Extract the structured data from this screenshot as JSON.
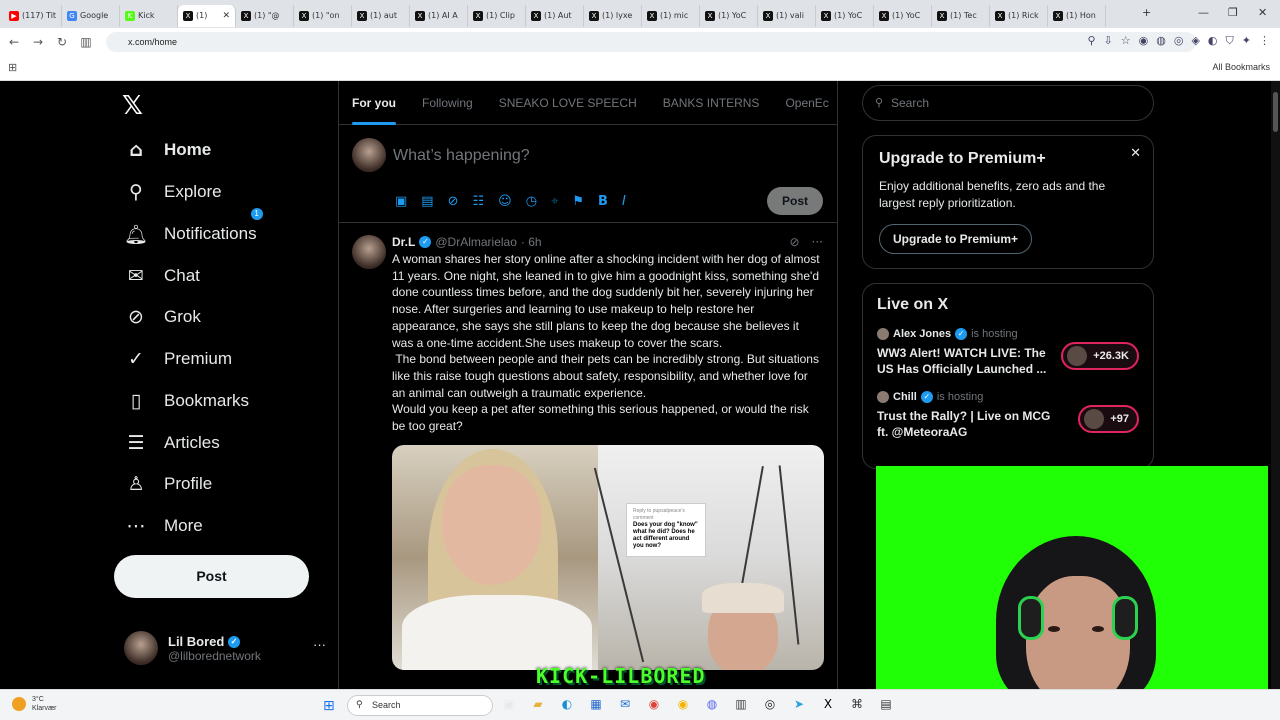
{
  "browser": {
    "tabs": [
      {
        "label": "(117) Tit",
        "fav": "▶",
        "fav_color": "#ff0000"
      },
      {
        "label": "Google",
        "fav": "G",
        "fav_color": "#4285f4"
      },
      {
        "label": "Kick",
        "fav": "K",
        "fav_color": "#53fc18"
      },
      {
        "label": "(1)",
        "fav": "X",
        "fav_color": "#111111",
        "active": true
      },
      {
        "label": "(1) \"@",
        "fav": "X",
        "fav_color": "#111111"
      },
      {
        "label": "(1) \"on",
        "fav": "X",
        "fav_color": "#111111"
      },
      {
        "label": "(1) aut",
        "fav": "X",
        "fav_color": "#111111"
      },
      {
        "label": "(1) AI A",
        "fav": "X",
        "fav_color": "#111111"
      },
      {
        "label": "(1) Clip",
        "fav": "X",
        "fav_color": "#111111"
      },
      {
        "label": "(1) Aut",
        "fav": "X",
        "fav_color": "#111111"
      },
      {
        "label": "(1) lyxe",
        "fav": "X",
        "fav_color": "#111111"
      },
      {
        "label": "(1) mic",
        "fav": "X",
        "fav_color": "#111111"
      },
      {
        "label": "(1) YoC",
        "fav": "X",
        "fav_color": "#111111"
      },
      {
        "label": "(1) vali",
        "fav": "X",
        "fav_color": "#111111"
      },
      {
        "label": "(1) YoC",
        "fav": "X",
        "fav_color": "#111111"
      },
      {
        "label": "(1) YoC",
        "fav": "X",
        "fav_color": "#111111"
      },
      {
        "label": "(1) Tec",
        "fav": "X",
        "fav_color": "#111111"
      },
      {
        "label": "(1) Rick",
        "fav": "X",
        "fav_color": "#111111"
      },
      {
        "label": "(1) Hon",
        "fav": "X",
        "fav_color": "#111111"
      }
    ],
    "url": "x.com/home",
    "all_bookmarks": "All Bookmarks"
  },
  "leftnav": {
    "logo": "𝕏",
    "items": [
      {
        "label": "Home",
        "icon": "⌂",
        "name": "home"
      },
      {
        "label": "Explore",
        "icon": "⚲",
        "name": "explore"
      },
      {
        "label": "Notifications",
        "icon": "🔔︎",
        "name": "notifications",
        "badge": "1"
      },
      {
        "label": "Chat",
        "icon": "✉",
        "name": "chat"
      },
      {
        "label": "Grok",
        "icon": "⊘",
        "name": "grok"
      },
      {
        "label": "Premium",
        "icon": "✓",
        "name": "premium"
      },
      {
        "label": "Bookmarks",
        "icon": "▯",
        "name": "bookmarks"
      },
      {
        "label": "Articles",
        "icon": "☰",
        "name": "articles"
      },
      {
        "label": "Profile",
        "icon": "♙",
        "name": "profile"
      },
      {
        "label": "More",
        "icon": "⋯",
        "name": "more"
      }
    ],
    "post_label": "Post",
    "profile": {
      "name": "Lil Bored",
      "handle": "@lilborednetwork"
    }
  },
  "main": {
    "tabs": [
      "For you",
      "Following",
      "SNEAKO LOVE SPEECH",
      "BANKS INTERNS",
      "OpenEc"
    ],
    "composer_placeholder": "What’s happening?",
    "composer_post": "Post",
    "tweet": {
      "name": "Dr.L",
      "handle": "@DrAlmarielao",
      "time": "· 6h",
      "text": "A woman shares her story online after a shocking incident with her dog of almost 11 years. One night, she leaned in to give him a goodnight kiss, something she'd done countless times before, and the dog suddenly bit her, severely injuring her nose. After surgeries and learning to use makeup to help restore her appearance, she says she still plans to keep the dog because she believes it was a one-time accident.She uses makeup to cover the scars.\n The bond between people and their pets can be incredibly strong. But situations like this raise tough questions about safety, responsibility, and whether love for an animal can outweigh a traumatic experience.\nWould you keep a pet after something this serious happened, or would the risk be too great?",
      "media_caption_title": "Does your dog \"know\" what he did? Does he act different around you now?",
      "media_caption_small": "Reply to pupsatpeace's comment"
    },
    "watermark": "KICK-LILBORED"
  },
  "right": {
    "search_placeholder": "Search",
    "premium": {
      "title": "Upgrade to Premium+",
      "desc": "Enjoy additional benefits, zero ads and the largest reply prioritization.",
      "button": "Upgrade to Premium+"
    },
    "live": {
      "title": "Live on X",
      "hosting": "is hosting",
      "items": [
        {
          "host": "Alex Jones",
          "text": "WW3 Alert! WATCH LIVE: The US Has Officially Launched ...",
          "count": "+26.3K"
        },
        {
          "host": "Chill",
          "text": "Trust the Rally? | Live on MCG ft. @MeteoraAG",
          "count": "+97"
        }
      ]
    }
  },
  "taskbar": {
    "weather_temp": "3°C",
    "weather_desc": "Klarvær",
    "search": "Search"
  },
  "colors": {
    "accent": "#1d9bf0",
    "greenscreen": "#21ff07",
    "live_border": "#e0245e"
  }
}
